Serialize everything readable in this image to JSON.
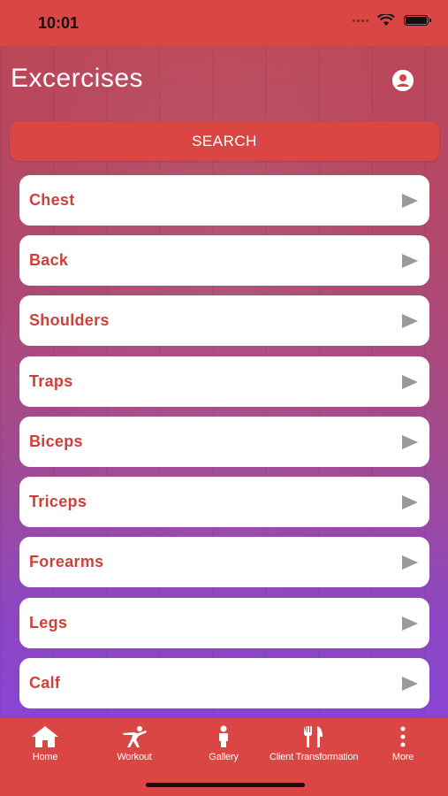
{
  "status": {
    "time": "10:01"
  },
  "header": {
    "title": "Excercises",
    "profile_icon": "user-circle-icon"
  },
  "search": {
    "label": "SEARCH"
  },
  "categories": [
    {
      "label": "Chest"
    },
    {
      "label": "Back"
    },
    {
      "label": "Shoulders"
    },
    {
      "label": "Traps"
    },
    {
      "label": "Biceps"
    },
    {
      "label": "Triceps"
    },
    {
      "label": "Forearms"
    },
    {
      "label": "Legs"
    },
    {
      "label": "Calf"
    }
  ],
  "tabs": [
    {
      "label": "Home",
      "icon": "home-icon"
    },
    {
      "label": "Workout",
      "icon": "workout-icon"
    },
    {
      "label": "Gallery",
      "icon": "person-icon"
    },
    {
      "label": "Client Transformation",
      "icon": "fork-knife-icon"
    },
    {
      "label": "More",
      "icon": "more-vertical-icon"
    }
  ],
  "colors": {
    "primary": "#d94643",
    "label_red": "#d13f3b",
    "gradient_top": "#c74c5d",
    "gradient_bottom": "#8944d3"
  }
}
